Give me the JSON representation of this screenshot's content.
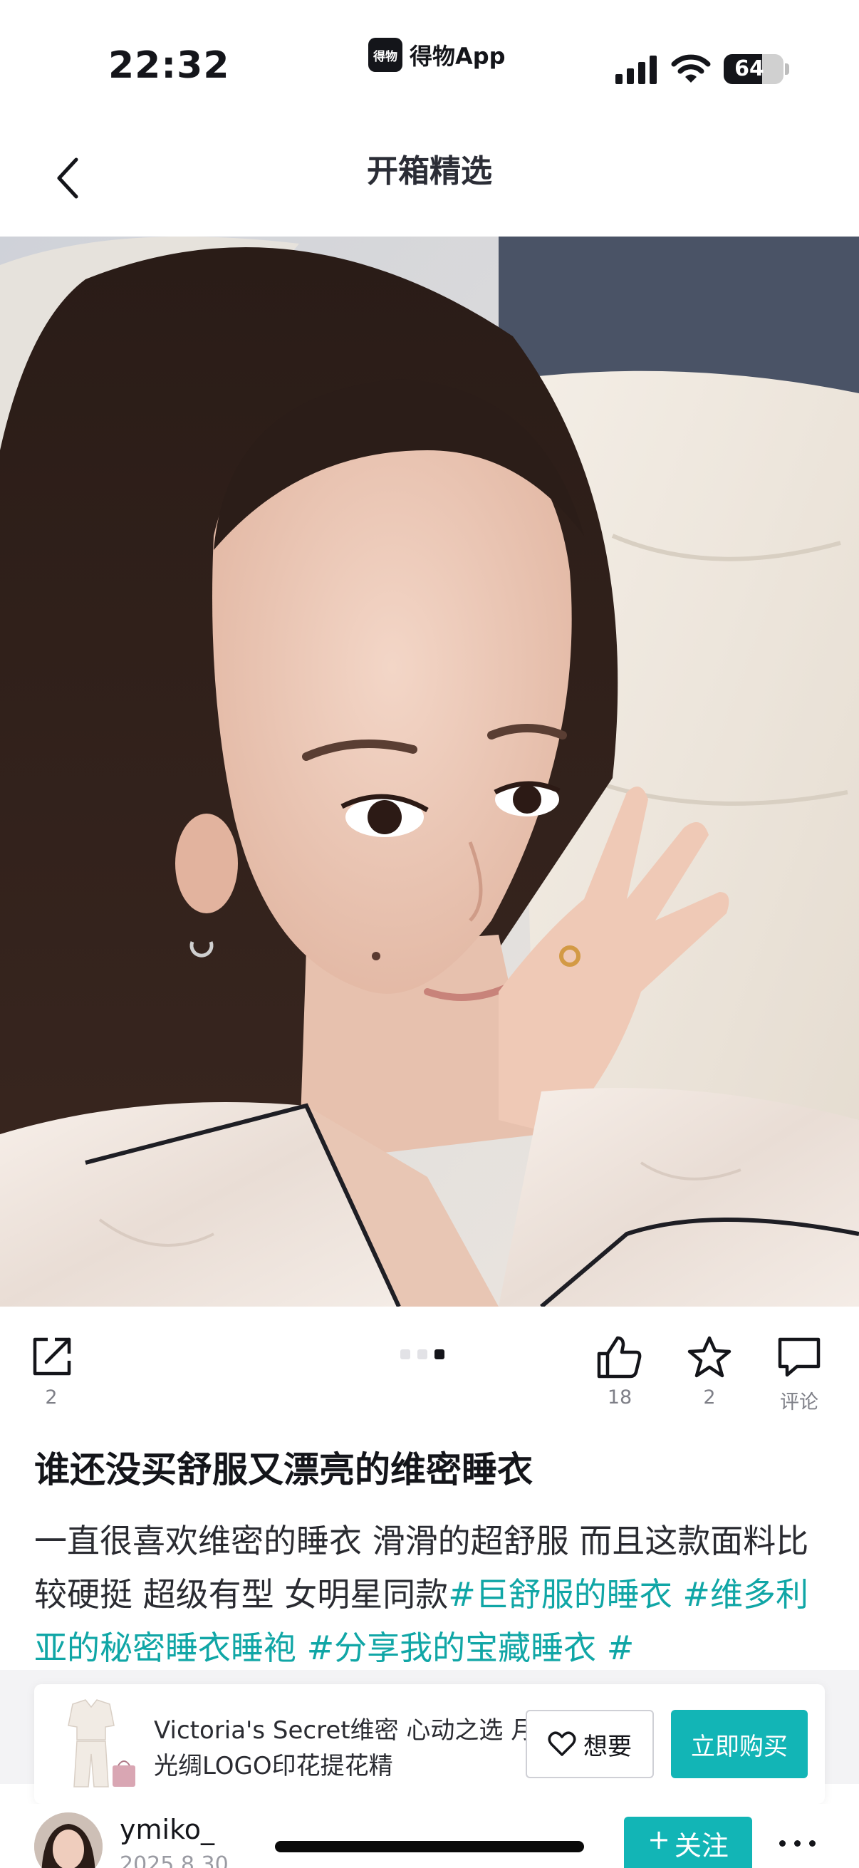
{
  "status_bar": {
    "time": "22:32",
    "app_badge": "得物",
    "app_label": "得物App",
    "battery": "64",
    "battery_level": 0.64
  },
  "nav": {
    "back_icon": "chevron-left-icon",
    "title": "开箱精选"
  },
  "photo": {
    "page_count": 3,
    "active_page": 3
  },
  "actions": {
    "share": {
      "icon": "share-icon",
      "count": "2"
    },
    "like": {
      "icon": "thumbs-up-icon",
      "count": "18"
    },
    "favorite": {
      "icon": "star-icon",
      "count": "2"
    },
    "comment": {
      "icon": "comment-icon",
      "label": "评论"
    }
  },
  "post": {
    "title": "谁还没买舒服又漂亮的维密睡衣",
    "body_text": "一直很喜欢维密的睡衣 滑滑的超舒服 而且这款面料比较硬挺 超级有型 女明星同款",
    "tags": [
      "#巨舒服的睡衣",
      "#维多利亚的秘密睡衣睡袍",
      "#分享我的宝藏睡衣",
      "#"
    ]
  },
  "product": {
    "name": "Victoria's Secret维密 心动之选 月光绸LOGO印花提花精",
    "want_label": "想要",
    "buy_label": "立即购买"
  },
  "author": {
    "name": "ymiko_",
    "date": "2025.8.30",
    "follow_label": "关注"
  },
  "colors": {
    "accent": "#12b5b6",
    "tag": "#10a6a6",
    "text": "#14151a",
    "muted": "#7e7f87"
  }
}
